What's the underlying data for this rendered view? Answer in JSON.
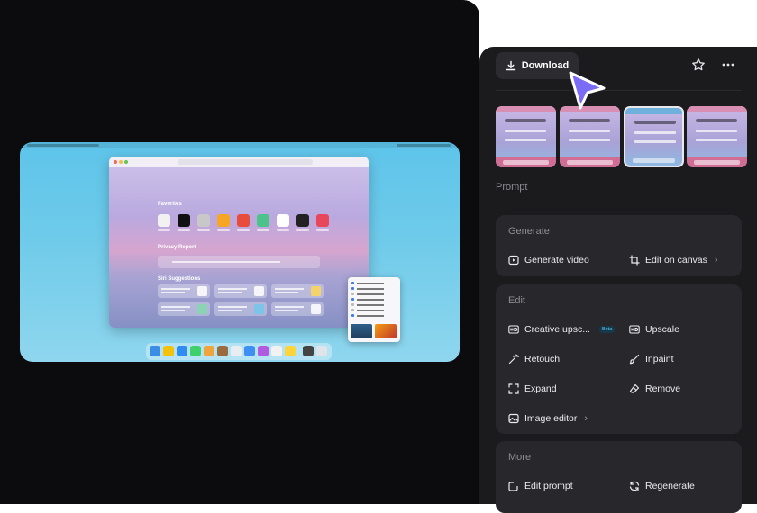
{
  "header": {
    "download_label": "Download",
    "star_icon": "star-icon",
    "more_icon": "more-icon"
  },
  "thumbnails": [
    {
      "label": "variant-1",
      "selected": false
    },
    {
      "label": "variant-2",
      "selected": false
    },
    {
      "label": "variant-3",
      "selected": true
    },
    {
      "label": "variant-4",
      "selected": false
    }
  ],
  "prompt": {
    "label": "Prompt"
  },
  "sections": {
    "generate": {
      "title": "Generate",
      "items": {
        "generate_video": "Generate video",
        "edit_on_canvas": "Edit on canvas"
      }
    },
    "edit": {
      "title": "Edit",
      "items": {
        "creative_upscale": "Creative upsc...",
        "creative_upscale_badge": "Beta",
        "upscale": "Upscale",
        "retouch": "Retouch",
        "inpaint": "Inpaint",
        "expand": "Expand",
        "remove": "Remove",
        "image_editor": "Image editor"
      }
    },
    "more": {
      "title": "More",
      "items": {
        "edit_prompt": "Edit prompt",
        "regenerate": "Regenerate"
      }
    }
  },
  "preview": {
    "favorites_title": "Favorites",
    "privacy_title": "Privacy Report",
    "siri_title": "Siri Suggestions"
  },
  "colors": {
    "panel_bg": "#1b1b1e",
    "card_bg": "#28282c",
    "canvas_bg": "#0c0c0e",
    "cursor": "#7b6cf6",
    "beta_text": "#5ed0f0"
  }
}
